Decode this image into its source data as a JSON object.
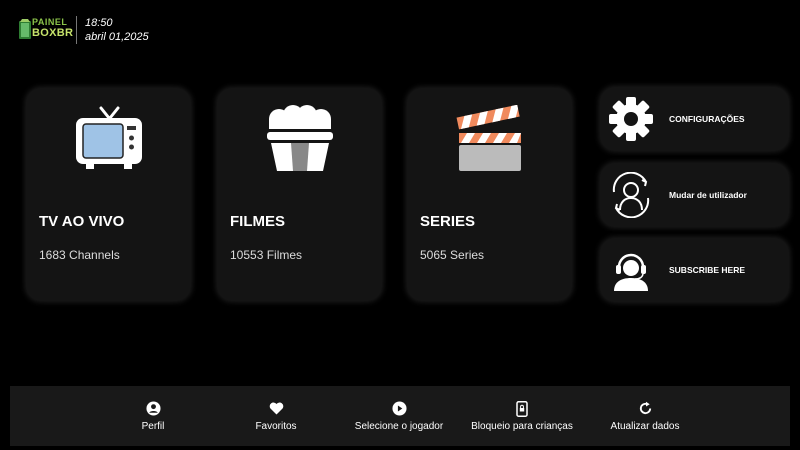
{
  "header": {
    "logo_line1": "PAINEL",
    "logo_line2": "BOXBR",
    "time": "18:50",
    "date": "abril 01,2025"
  },
  "cards": [
    {
      "title": "TV AO VIVO",
      "count": "1683 Channels",
      "icon": "tv-icon"
    },
    {
      "title": "FILMES",
      "count": "10553 Filmes",
      "icon": "popcorn-icon"
    },
    {
      "title": "SERIES",
      "count": "5065 Series",
      "icon": "clapperboard-icon"
    }
  ],
  "side": [
    {
      "label": "CONFIGURAÇÕES",
      "icon": "gear-icon"
    },
    {
      "label": "Mudar de utilizador",
      "icon": "user-switch-icon"
    },
    {
      "label": "SUBSCRIBE HERE",
      "icon": "support-agent-icon"
    }
  ],
  "bottom": [
    {
      "label": "Perfil",
      "icon": "profile-icon"
    },
    {
      "label": "Favoritos",
      "icon": "heart-icon"
    },
    {
      "label": "Selecione o jogador",
      "icon": "play-icon"
    },
    {
      "label": "Bloqueio para crianças",
      "icon": "phone-lock-icon"
    },
    {
      "label": "Atualizar dados",
      "icon": "refresh-icon"
    }
  ],
  "colors": {
    "background": "#000000",
    "card": "#141414",
    "bottom_bar": "#191919",
    "clapper_accent": "#f08a5d",
    "tv_screen": "#9fc3e6",
    "logo_green": "#8bc34a"
  }
}
